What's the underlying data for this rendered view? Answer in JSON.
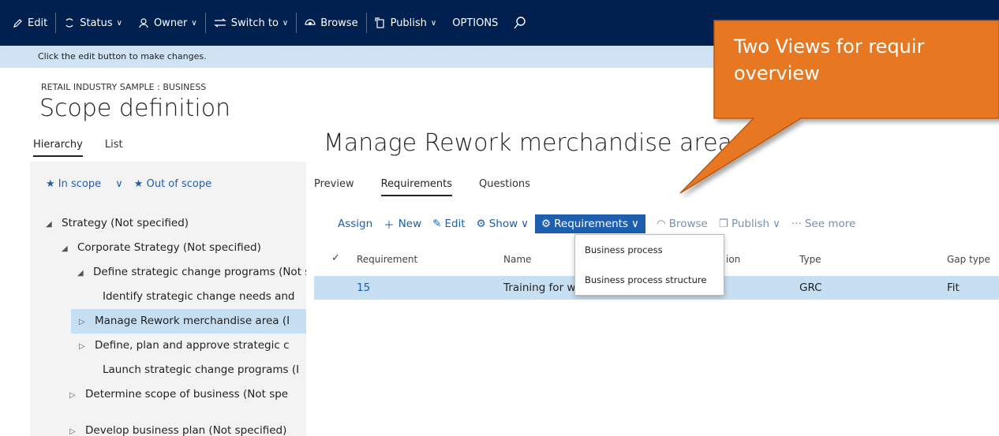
{
  "toolbar": {
    "edit": "Edit",
    "status": "Status",
    "owner": "Owner",
    "switch_to": "Switch to",
    "browse": "Browse",
    "publish": "Publish",
    "options": "OPTIONS"
  },
  "message": "Click the edit button to make changes.",
  "breadcrumb": "RETAIL INDUSTRY SAMPLE : BUSINESS",
  "page_title": "Scope definition",
  "left_tabs": [
    "Hierarchy",
    "List"
  ],
  "scope_filters": [
    "In scope",
    "Out of scope"
  ],
  "tree": [
    "Strategy (Not specified)",
    "Corporate Strategy (Not specified)",
    "Define strategic change programs (Not specified)",
    "Identify strategic change needs and",
    "Manage Rework merchandise area (I",
    "Define, plan and approve strategic c",
    "Launch strategic change programs (I",
    "Determine scope of business (Not spe",
    "Develop business plan (Not specified)"
  ],
  "main_title": "Manage Rework merchandise area",
  "sub_tabs": [
    "Preview",
    "Requirements",
    "Questions"
  ],
  "actions": {
    "assign": "Assign",
    "new": "New",
    "edit": "Edit",
    "show": "Show",
    "requirements": "Requirements",
    "browse": "Browse",
    "publish": "Publish",
    "see_more": "See more"
  },
  "grid": {
    "headers": [
      "Requirement",
      "Name",
      "ion",
      "Type",
      "Gap type"
    ],
    "row": {
      "requirement": "15",
      "name": "Training for w",
      "type": "GRC",
      "gap_type": "Fit"
    }
  },
  "dropdown": [
    "Business process",
    "Business process structure"
  ],
  "callout": {
    "line1": "Two Views for requir",
    "line2": "overview"
  },
  "colors": {
    "topbar": "#002050",
    "accent": "#1d5fae",
    "callout": "#e87722",
    "selection": "#c7dff2"
  }
}
